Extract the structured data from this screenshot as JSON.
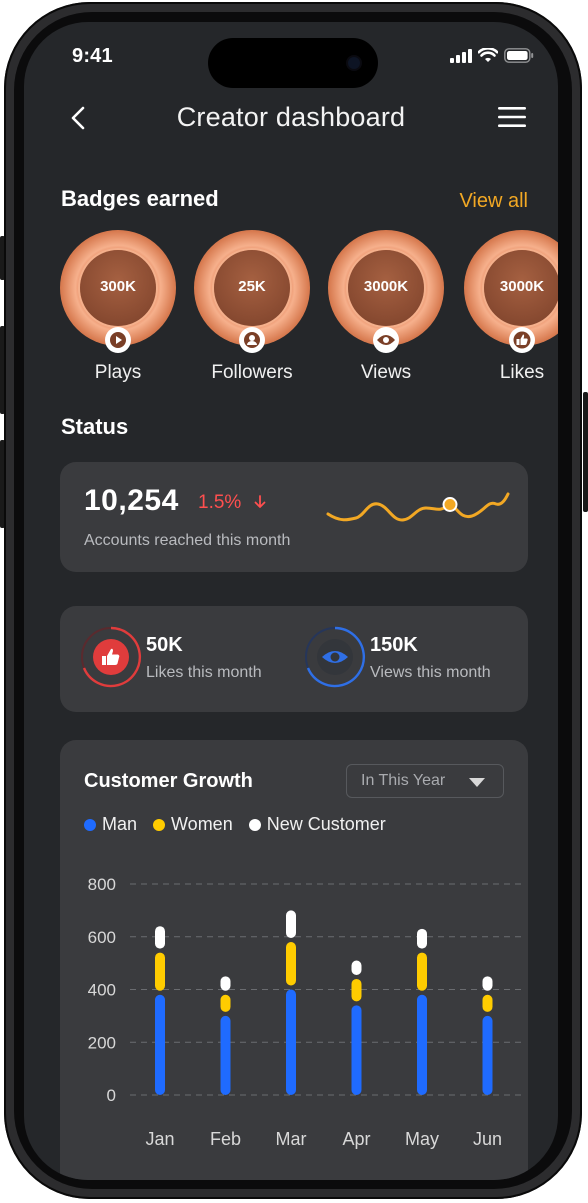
{
  "status_bar": {
    "time": "9:41"
  },
  "nav": {
    "title": "Creator dashboard"
  },
  "badges_section": {
    "title": "Badges earned",
    "view_all": "View all",
    "badges": [
      {
        "value": "300K",
        "label": "Plays",
        "icon": "play-icon"
      },
      {
        "value": "25K",
        "label": "Followers",
        "icon": "person-icon"
      },
      {
        "value": "3000K",
        "label": "Views",
        "icon": "eye-icon"
      },
      {
        "value": "3000K",
        "label": "Likes",
        "icon": "thumbs-up-icon"
      }
    ]
  },
  "status_section": {
    "title": "Status",
    "reach": {
      "value": "10,254",
      "change": "1.5%",
      "change_icon": "arrow-down-icon",
      "label": "Accounts reached this month"
    },
    "likes": {
      "value": "50K",
      "label": "Likes this month"
    },
    "views": {
      "value": "150K",
      "label": "Views this month"
    }
  },
  "customer_growth": {
    "title": "Customer Growth",
    "period": "In This Year",
    "legend": [
      "Man",
      "Women",
      "New Customer"
    ]
  },
  "colors": {
    "accent_orange": "#f2a824",
    "negative_red": "#ff4f4f",
    "man_blue": "#1f6bff",
    "women_yellow": "#ffcc00",
    "new_customer_white": "#ffffff",
    "likes_ring": "#e03c3c",
    "views_ring": "#2f6fe6"
  },
  "chart_data": {
    "type": "bar",
    "stacked": true,
    "categories": [
      "Jan",
      "Feb",
      "Mar",
      "Apr",
      "May",
      "Jun"
    ],
    "series": [
      {
        "name": "Man",
        "values": [
          380,
          300,
          400,
          340,
          380,
          300
        ]
      },
      {
        "name": "Women",
        "values": [
          160,
          80,
          180,
          100,
          160,
          80
        ]
      },
      {
        "name": "New Customer",
        "values": [
          100,
          70,
          120,
          70,
          90,
          70
        ]
      }
    ],
    "yticks": [
      0,
      200,
      400,
      600,
      800
    ],
    "ylim": [
      0,
      800
    ],
    "grid": true
  }
}
